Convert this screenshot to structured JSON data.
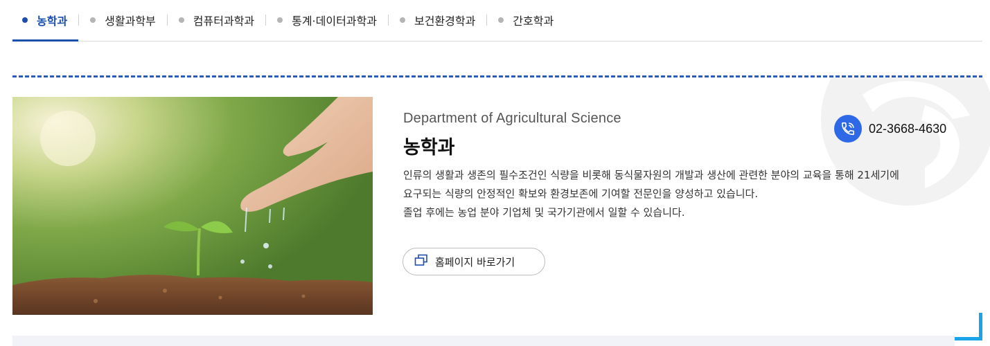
{
  "tabs": [
    {
      "label": "농학과",
      "active": true
    },
    {
      "label": "생활과학부",
      "active": false
    },
    {
      "label": "컴퓨터과학과",
      "active": false
    },
    {
      "label": "통계·데이터과학과",
      "active": false
    },
    {
      "label": "보건환경학과",
      "active": false
    },
    {
      "label": "간호학과",
      "active": false
    }
  ],
  "department": {
    "english_name": "Department of Agricultural Science",
    "name": "농학과",
    "description": [
      "인류의 생활과 생존의 필수조건인 식량을 비롯해 동식물자원의 개발과 생산에 관련한 분야의 교육을 통해 21세기에",
      "요구되는 식량의 안정적인 확보와 환경보존에 기여할 전문인을 양성하고 있습니다.",
      "졸업 후에는 농업 분야 기업체 및 국가기관에서 일할 수 있습니다."
    ],
    "phone": "02-3668-4630",
    "homepage_button": "홈페이지 바로가기"
  },
  "icons": {
    "phone": "phone-icon",
    "homepage": "new-window-icon"
  },
  "colors": {
    "accent": "#1a4fae",
    "phone_badge": "#2f68e6",
    "corner_accent": "#1aa3e8"
  }
}
